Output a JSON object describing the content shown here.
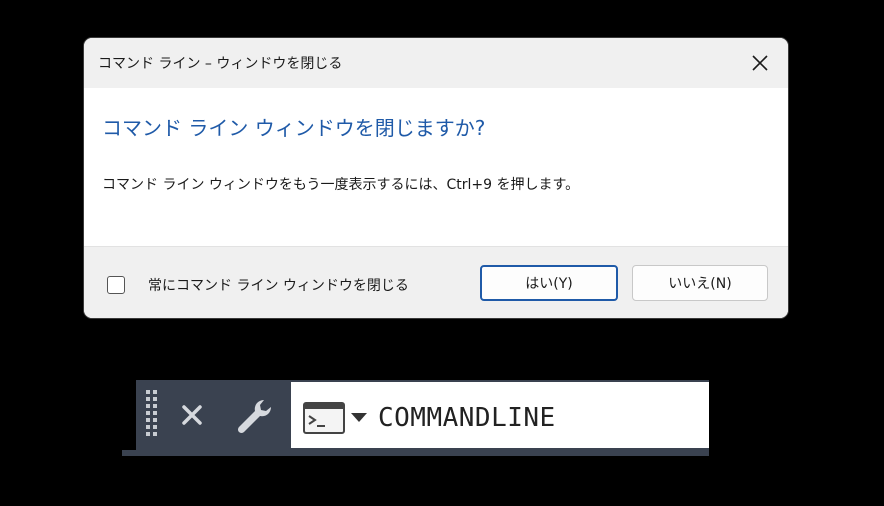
{
  "dialog": {
    "title": "コマンド ライン – ウィンドウを閉じる",
    "heading": "コマンド ライン ウィンドウを閉じますか?",
    "body": "コマンド ライン ウィンドウをもう一度表示するには、Ctrl+9 を押します。",
    "checkbox_label": "常にコマンド ライン ウィンドウを閉じる",
    "checkbox_checked": false,
    "yes_label": "はい(Y)",
    "no_label": "いいえ(N)",
    "accent_color": "#1f5aa8"
  },
  "command_line": {
    "text": "COMMANDLINE",
    "icons": [
      "grip-icon",
      "close-icon",
      "wrench-icon",
      "terminal-icon",
      "chevron-down-icon"
    ]
  }
}
